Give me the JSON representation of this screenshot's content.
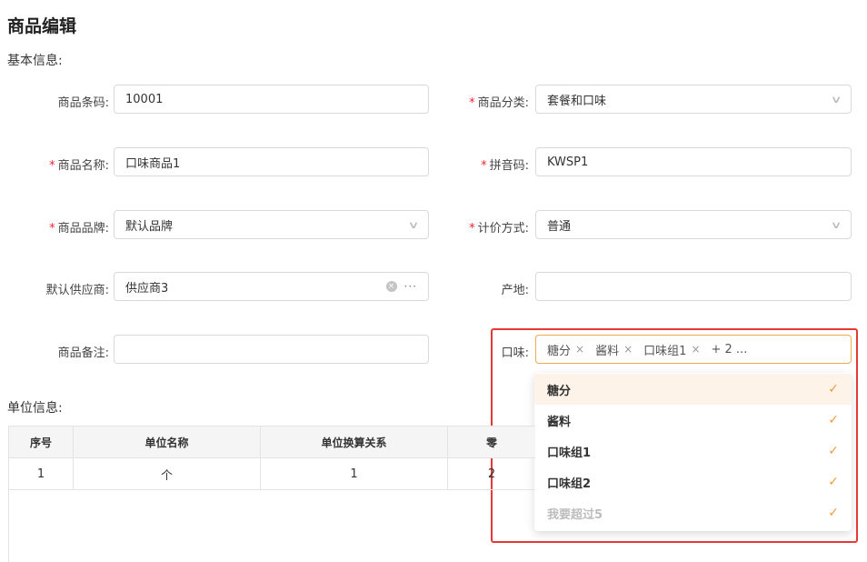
{
  "page_title": "商品编辑",
  "basic_section": "基本信息:",
  "form": {
    "barcode": {
      "label": "商品条码:",
      "value": "10001"
    },
    "category": {
      "label": "商品分类:",
      "value": "套餐和口味"
    },
    "name": {
      "label": "商品名称:",
      "value": "口味商品1"
    },
    "pinyin": {
      "label": "拼音码:",
      "value": "KWSP1"
    },
    "brand": {
      "label": "商品品牌:",
      "value": "默认品牌"
    },
    "pricing": {
      "label": "计价方式:",
      "value": "普通"
    },
    "supplier": {
      "label": "默认供应商:",
      "value": "供应商3"
    },
    "origin": {
      "label": "产地:",
      "value": ""
    },
    "remark": {
      "label": "商品备注:",
      "value": ""
    },
    "flavor": {
      "label": "口味:",
      "tags": [
        "糖分",
        "酱料",
        "口味组1"
      ],
      "more": "+ 2 ..."
    }
  },
  "required_mark": "*",
  "flavor_options": [
    {
      "label": "糖分",
      "checked": true,
      "active": true,
      "disabled": false
    },
    {
      "label": "酱料",
      "checked": true,
      "active": false,
      "disabled": false
    },
    {
      "label": "口味组1",
      "checked": true,
      "active": false,
      "disabled": false
    },
    {
      "label": "口味组2",
      "checked": true,
      "active": false,
      "disabled": false
    },
    {
      "label": "我要超过5",
      "checked": true,
      "active": false,
      "disabled": true
    }
  ],
  "check_glyph": "✓",
  "unit_section": "单位信息:",
  "units_table": {
    "headers": [
      "序号",
      "单位名称",
      "单位换算关系",
      "零"
    ],
    "rows": [
      [
        "1",
        "个",
        "1",
        "2"
      ]
    ]
  },
  "icons": {
    "chevron": "chevron-down-icon",
    "clear": "clear-icon",
    "more": "ellipsis-icon",
    "remove": "close-icon"
  },
  "colors": {
    "required": "#f5222d",
    "check": "#f09c3c",
    "highlight": "#e53935",
    "active_option_bg": "#fdf3e8",
    "focus_border": "#f0a94e"
  }
}
